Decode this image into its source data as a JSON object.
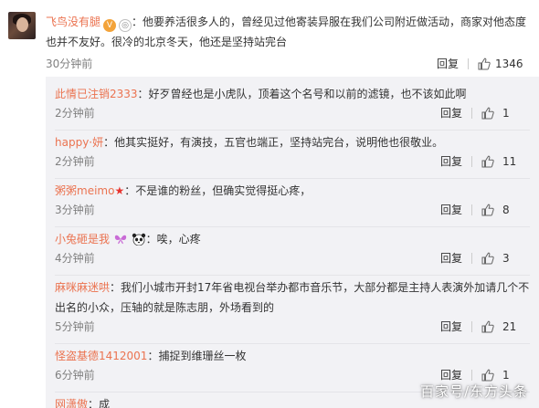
{
  "main": {
    "username": "飞鸟没有腿",
    "badges": [
      "vip-badge-icon",
      "medal-icon"
    ],
    "text": "：他要养活很多人的，曾经见过他寄装异服在我们公司附近做活动，商家对他态度也并不友好。很冷的北京冬天，他还是坚持站完台",
    "time": "30分钟前",
    "reply_label": "回复",
    "likes": "1346",
    "like_icon": "thumbs-up-icon"
  },
  "replies": [
    {
      "username": "此情已注销2333",
      "text": "：好歹曾经也是小虎队，顶着这个名号和以前的滤镜，也不该如此啊",
      "time": "2分钟前",
      "reply_label": "回复",
      "likes": "1"
    },
    {
      "username": "happy·妍",
      "text": "：他其实挺好，有演技，五官也端正，坚持站完台，说明他也很敬业。",
      "time": "2分钟前",
      "reply_label": "回复",
      "likes": "11"
    },
    {
      "username": "粥粥meimo",
      "star": "★",
      "text": "：不是谁的粉丝，但确实觉得挺心疼，",
      "time": "3分钟前",
      "reply_label": "回复",
      "likes": "8"
    },
    {
      "username": "小兔砸是我",
      "text": "：唉，心疼",
      "time": "4分钟前",
      "reply_label": "回复",
      "likes": "3"
    },
    {
      "username": "麻咪麻迷哄",
      "text": "：我们小城市开封17年省电视台举办都市音乐节，大部分都是主持人表演外加请几个不出名的小众，压轴的就是陈志朋，外场看到的",
      "time": "5分钟前",
      "reply_label": "回复",
      "likes": "21"
    },
    {
      "username": "怪盗基德1412001",
      "text": "：捕捉到维珊丝一枚",
      "time": "6分钟前",
      "reply_label": "回复",
      "likes": "1"
    },
    {
      "username": "网潇傲",
      "text": "：成",
      "time": "",
      "reply_label": "",
      "likes": ""
    }
  ],
  "watermark": "百家号/东方头条",
  "colors": {
    "username": "#eb7350",
    "reply_bg": "#f2f2f5",
    "time": "#808080",
    "star": "#e8342f"
  }
}
